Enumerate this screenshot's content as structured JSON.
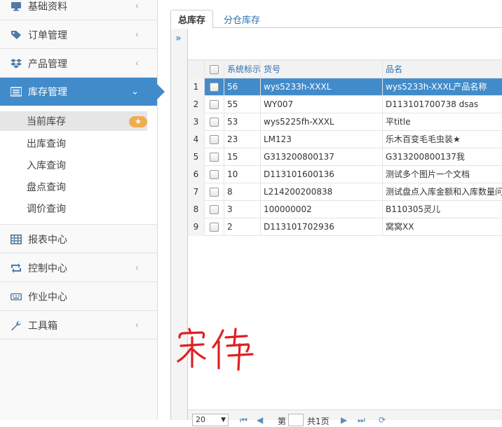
{
  "sidebar": {
    "items": [
      {
        "label": "基础资料",
        "icon": "monitor-icon",
        "has_arrow": true
      },
      {
        "label": "订单管理",
        "icon": "tag-icon",
        "has_arrow": true
      },
      {
        "label": "产品管理",
        "icon": "dropbox-icon",
        "has_arrow": true
      },
      {
        "label": "库存管理",
        "icon": "list-icon",
        "has_arrow": true,
        "active": true
      },
      {
        "label": "报表中心",
        "icon": "table-icon",
        "has_arrow": false
      },
      {
        "label": "控制中心",
        "icon": "retweet-icon",
        "has_arrow": true
      },
      {
        "label": "作业中心",
        "icon": "keyboard-icon",
        "has_arrow": false
      },
      {
        "label": "工具箱",
        "icon": "wrench-icon",
        "has_arrow": true
      }
    ],
    "submenu": [
      {
        "label": "当前库存",
        "current": true
      },
      {
        "label": "出库查询"
      },
      {
        "label": "入库查询"
      },
      {
        "label": "盘点查询"
      },
      {
        "label": "调价查询"
      }
    ],
    "arrow_left": "‹",
    "arrow_down": "⌄",
    "badge_icon": "star-icon"
  },
  "tabs": [
    {
      "label": "总库存",
      "active": true
    },
    {
      "label": "分仓库存",
      "active": false
    }
  ],
  "expand_glyph": "»",
  "grid": {
    "columns": [
      "",
      "",
      "系统标示",
      "货号",
      "品名"
    ],
    "rows": [
      {
        "num": "1",
        "id": "56",
        "code": "wys5233h-XXXL",
        "name": "wys5233h-XXXL产品名称",
        "selected": true
      },
      {
        "num": "2",
        "id": "55",
        "code": "WY007",
        "name": "D113101700738 dsas"
      },
      {
        "num": "3",
        "id": "53",
        "code": "wys5225fh-XXXL",
        "name": "平title"
      },
      {
        "num": "4",
        "id": "23",
        "code": "LM123",
        "name": "乐木百变毛毛虫装★"
      },
      {
        "num": "5",
        "id": "15",
        "code": "G313200800137",
        "name": "G313200800137我"
      },
      {
        "num": "6",
        "id": "10",
        "code": "D113101600136",
        "name": "测试多个图片一个文档"
      },
      {
        "num": "7",
        "id": "8",
        "code": "L214200200838",
        "name": "测试盘点入库金额和入库数量问"
      },
      {
        "num": "8",
        "id": "3",
        "code": "100000002",
        "name": "B110305灵儿"
      },
      {
        "num": "9",
        "id": "2",
        "code": "D113101702936",
        "name": "窝窝XX"
      }
    ]
  },
  "pager": {
    "page_size": "20",
    "page_prefix": "第",
    "page_suffix": "共1页",
    "first": "⏮",
    "prev": "◀",
    "next": "▶",
    "last": "⏭",
    "refresh": "⟳"
  },
  "signature": {
    "text": "宋伟",
    "color": "#e02020"
  },
  "colors": {
    "accent": "#428bca",
    "link": "#2a6fb0",
    "badge": "#f0ad4e"
  }
}
